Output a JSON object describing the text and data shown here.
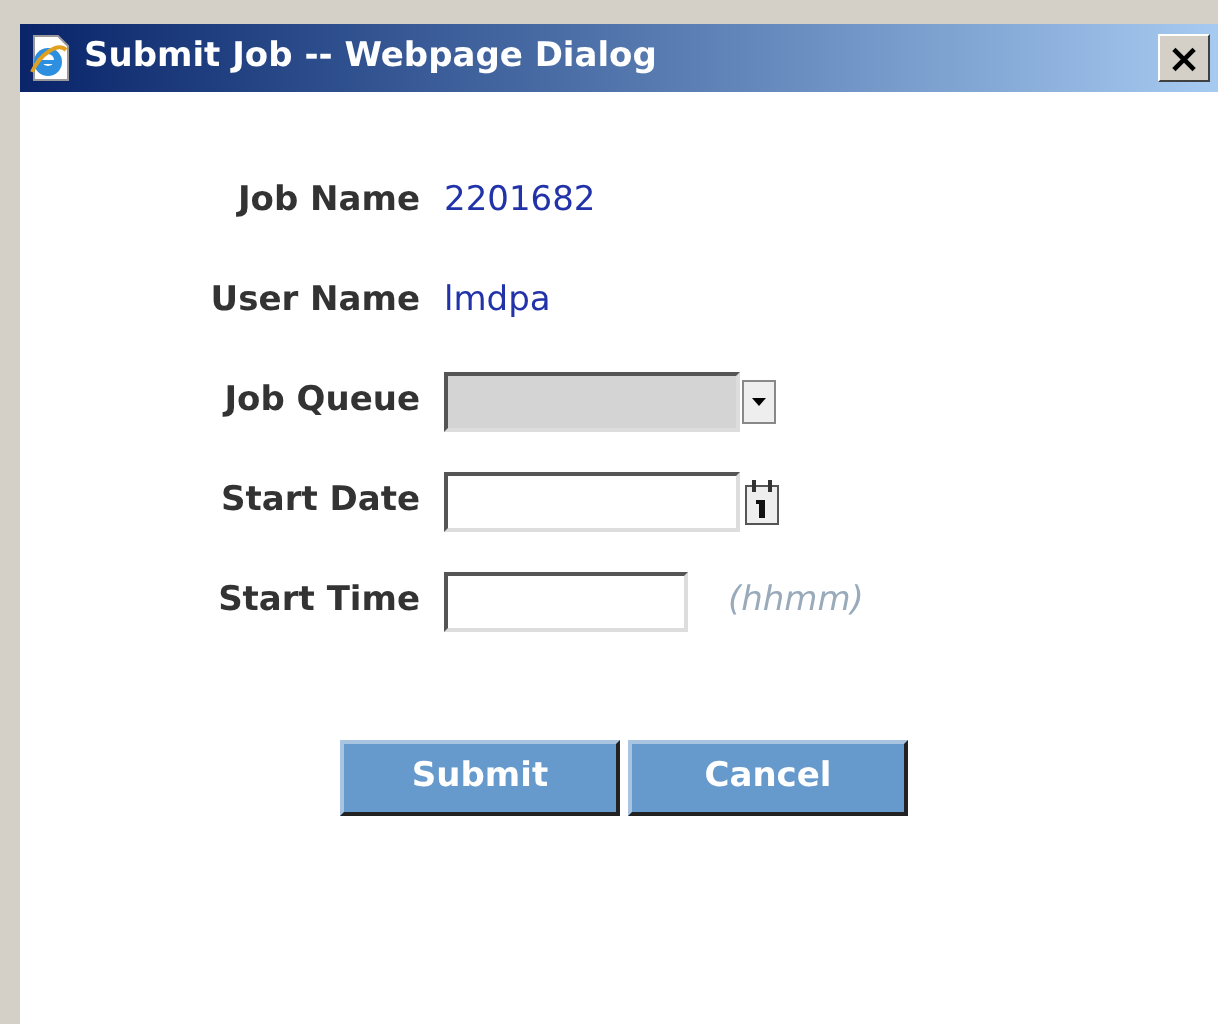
{
  "window": {
    "title": "Submit Job -- Webpage Dialog",
    "close": "×"
  },
  "info": [
    {
      "label": "Job Name",
      "value": "2201682"
    },
    {
      "label": "User Name",
      "value": "lmdpa"
    }
  ],
  "fields": [
    {
      "kind": "select",
      "label": "Job Queue",
      "disabled": true
    },
    {
      "kind": "date",
      "label": "Start Date",
      "disabled": false
    },
    {
      "kind": "time",
      "label": "Start Time",
      "disabled": false,
      "hint": "(hhmm)"
    }
  ],
  "buttons": [
    "Submit",
    "Cancel"
  ]
}
